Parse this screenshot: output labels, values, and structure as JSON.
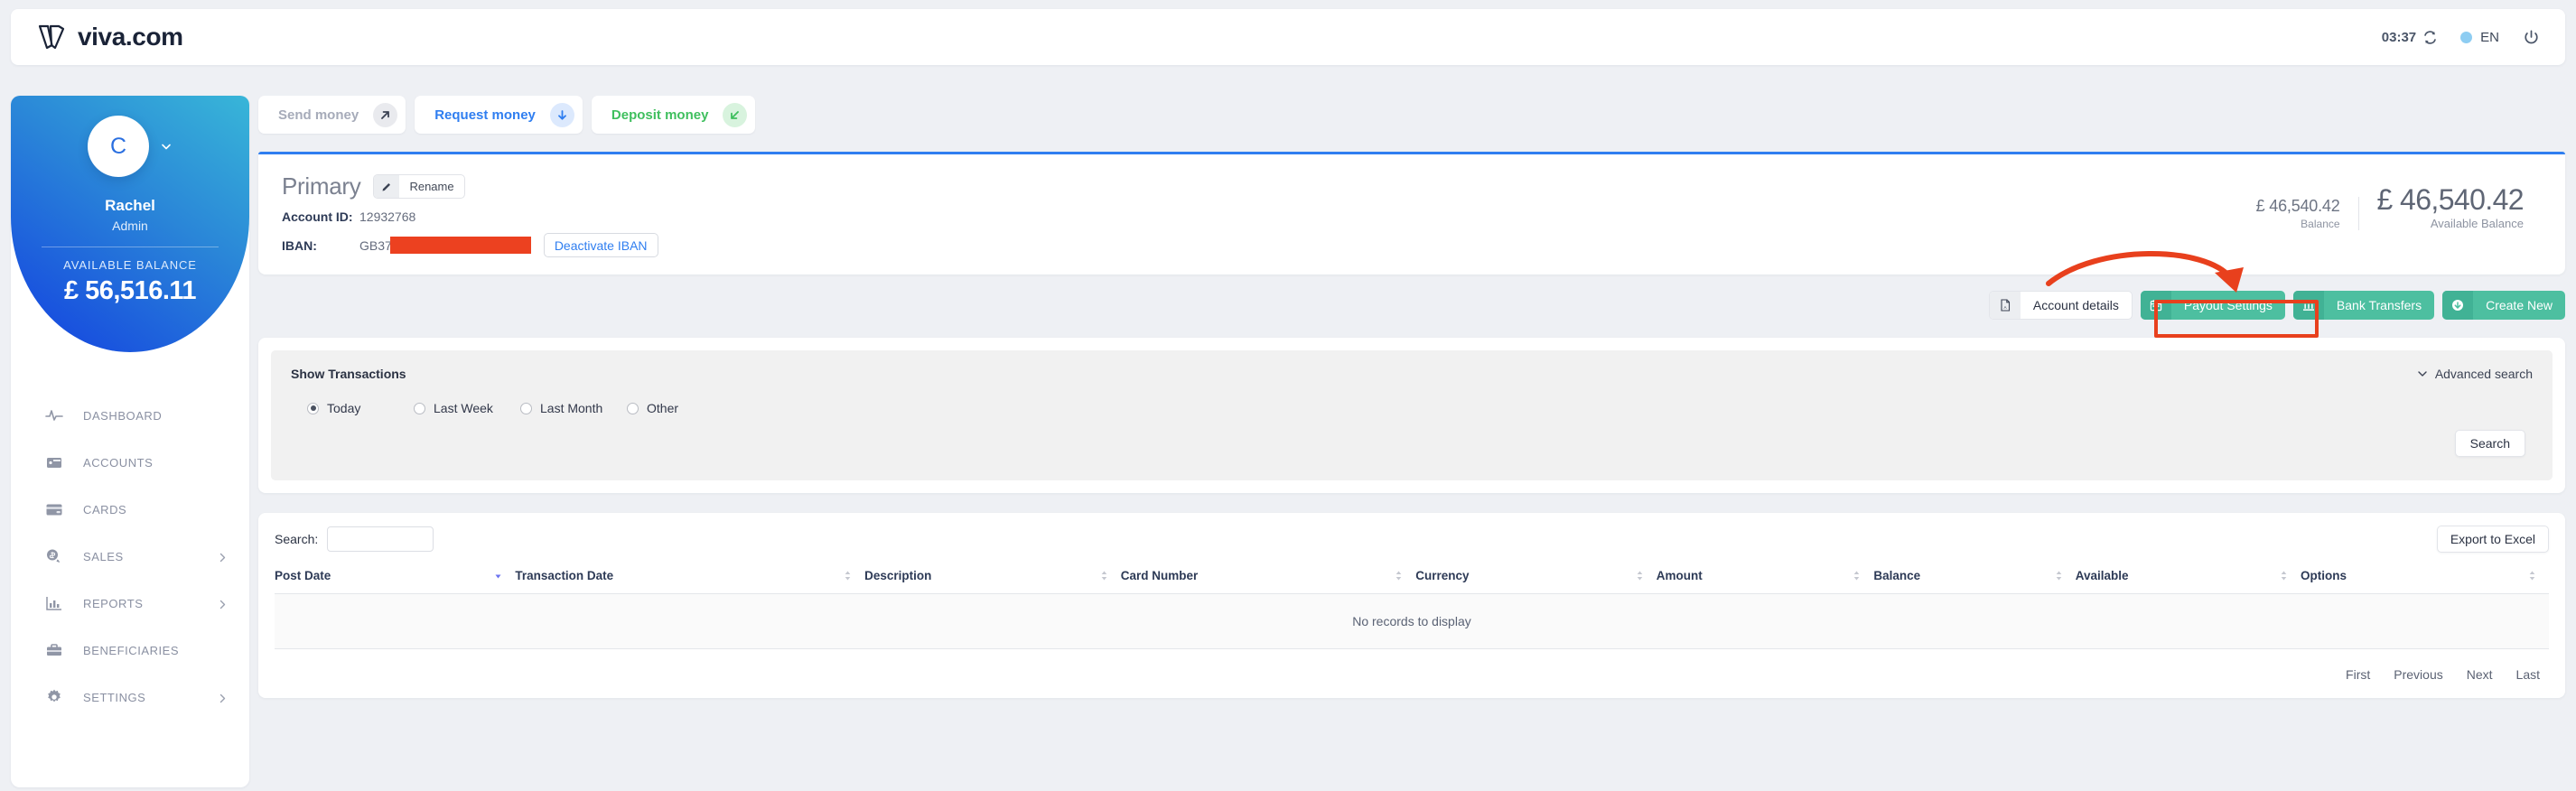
{
  "topbar": {
    "brand": "viva.com",
    "brand_icon": "viva-logo-icon",
    "time": "03:37",
    "refresh_icon": "refresh-icon",
    "language": "EN",
    "language_icon": "globe-dot-icon",
    "power_icon": "power-icon"
  },
  "sidebar": {
    "avatar_initial": "C",
    "avatar_caret_icon": "chevron-down-icon",
    "name": "Rachel",
    "role": "Admin",
    "balance_label": "AVAILABLE BALANCE",
    "balance_value": "£ 56,516.11",
    "items": [
      {
        "label": "DASHBOARD",
        "icon": "pulse-icon",
        "has_chevron": false
      },
      {
        "label": "ACCOUNTS",
        "icon": "wallet-icon",
        "has_chevron": false
      },
      {
        "label": "CARDS",
        "icon": "card-icon",
        "has_chevron": false
      },
      {
        "label": "SALES",
        "icon": "sales-coin-icon",
        "has_chevron": true
      },
      {
        "label": "REPORTS",
        "icon": "bar-chart-icon",
        "has_chevron": true
      },
      {
        "label": "BENEFICIARIES",
        "icon": "briefcase-icon",
        "has_chevron": false
      },
      {
        "label": "SETTINGS",
        "icon": "gear-icon",
        "has_chevron": true
      }
    ]
  },
  "quick_actions": [
    {
      "label": "Send money",
      "icon": "arrow-up-right-icon",
      "style": "send"
    },
    {
      "label": "Request money",
      "icon": "arrow-down-icon",
      "style": "request"
    },
    {
      "label": "Deposit money",
      "icon": "arrow-down-left-icon",
      "style": "deposit"
    }
  ],
  "account": {
    "title": "Primary",
    "rename_label": "Rename",
    "rename_icon": "pencil-icon",
    "account_id_label": "Account ID:",
    "account_id_value": "12932768",
    "iban_label": "IBAN:",
    "iban_value": "GB37",
    "iban_redacted": true,
    "deactivate_label": "Deactivate IBAN",
    "balance_small_amount": "£ 46,540.42",
    "balance_small_caption": "Balance",
    "balance_large_amount": "£ 46,540.42",
    "balance_large_caption": "Available Balance"
  },
  "account_actions": [
    {
      "label": "Account details",
      "icon": "pdf-file-icon",
      "style": "plain"
    },
    {
      "label": "Payout Settings",
      "icon": "calendar-icon",
      "style": "green",
      "highlighted": true
    },
    {
      "label": "Bank Transfers",
      "icon": "bank-icon",
      "style": "green"
    },
    {
      "label": "Create New",
      "icon": "plus-circle-icon",
      "style": "green"
    }
  ],
  "filters": {
    "title": "Show Transactions",
    "options": [
      {
        "label": "Today",
        "selected": true
      },
      {
        "label": "Last Week",
        "selected": false
      },
      {
        "label": "Last Month",
        "selected": false
      },
      {
        "label": "Other",
        "selected": false
      }
    ],
    "advanced_search_label": "Advanced search",
    "advanced_search_icon": "chevron-down-icon",
    "search_button": "Search"
  },
  "table": {
    "search_label": "Search:",
    "search_value": "",
    "export_label": "Export to Excel",
    "columns": [
      {
        "label": "Post Date",
        "sort": "desc"
      },
      {
        "label": "Transaction Date",
        "sort": "none"
      },
      {
        "label": "Description",
        "sort": "none"
      },
      {
        "label": "Card Number",
        "sort": "none"
      },
      {
        "label": "Currency",
        "sort": "none"
      },
      {
        "label": "Amount",
        "sort": "none"
      },
      {
        "label": "Balance",
        "sort": "none"
      },
      {
        "label": "Available",
        "sort": "none"
      },
      {
        "label": "Options",
        "sort": "none"
      }
    ],
    "empty_message": "No records to display",
    "pager": [
      "First",
      "Previous",
      "Next",
      "Last"
    ]
  },
  "annotation": {
    "highlight_color": "#e8401d",
    "target": "Payout Settings"
  }
}
